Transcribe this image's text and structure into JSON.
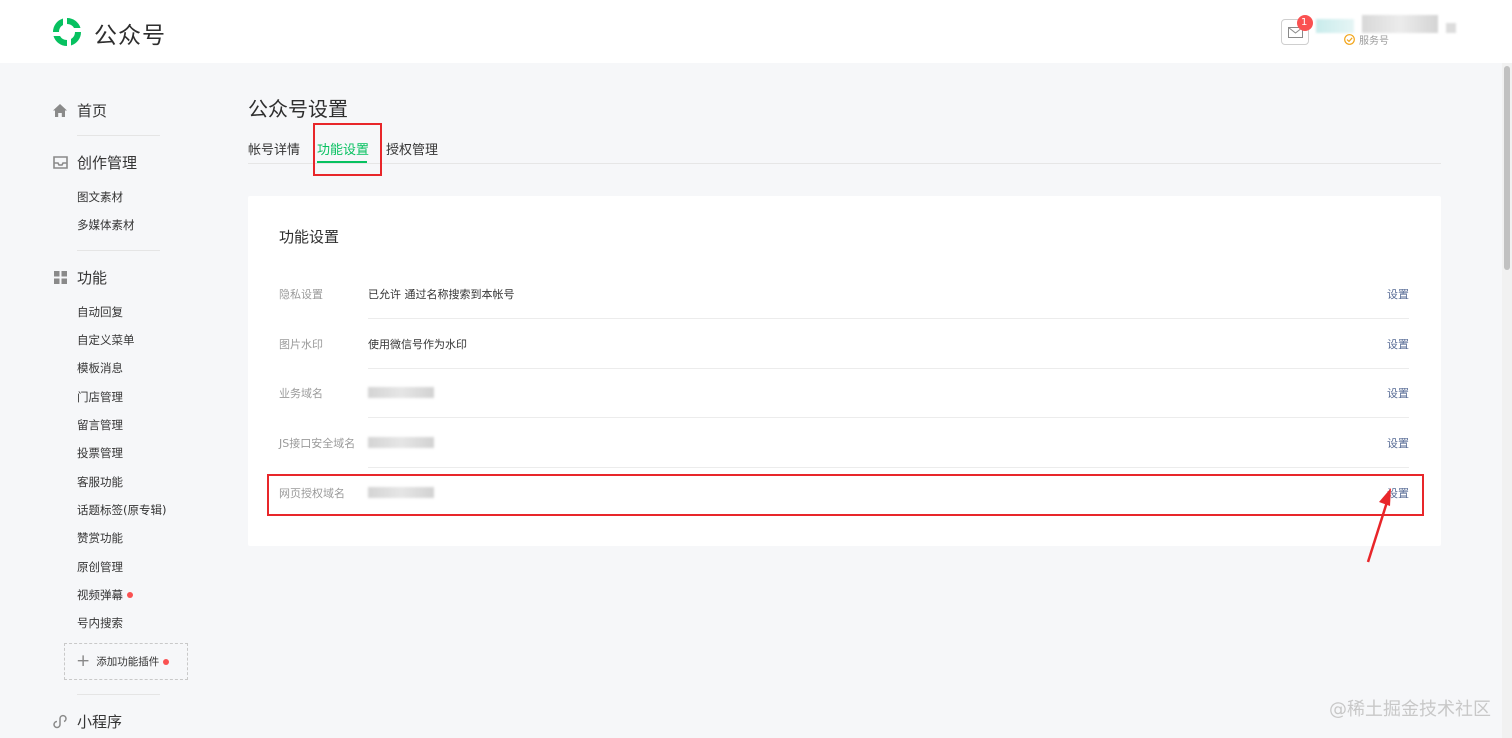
{
  "header": {
    "brand": "公众号",
    "notification_count": "1",
    "account_type": "服务号"
  },
  "sidebar": {
    "home": "首页",
    "creation": {
      "label": "创作管理",
      "items": [
        "图文素材",
        "多媒体素材"
      ]
    },
    "features": {
      "label": "功能",
      "items": [
        "自动回复",
        "自定义菜单",
        "模板消息",
        "门店管理",
        "留言管理",
        "投票管理",
        "客服功能",
        "话题标签(原专辑)",
        "赞赏功能",
        "原创管理",
        "视频弹幕",
        "号内搜索"
      ]
    },
    "add_plugin": "添加功能插件",
    "mini_program": "小程序"
  },
  "main": {
    "title": "公众号设置",
    "tabs": [
      "帐号详情",
      "功能设置",
      "授权管理"
    ],
    "active_tab": "功能设置",
    "card": {
      "title": "功能设置",
      "rows": [
        {
          "label": "隐私设置",
          "value": "已允许 通过名称搜索到本帐号",
          "action": "设置"
        },
        {
          "label": "图片水印",
          "value": "使用微信号作为水印",
          "action": "设置"
        },
        {
          "label": "业务域名",
          "value": "",
          "action": "设置"
        },
        {
          "label": "JS接口安全域名",
          "value": "",
          "action": "设置"
        },
        {
          "label": "网页授权域名",
          "value": "",
          "action": "设置"
        }
      ]
    }
  },
  "watermark": "@稀土掘金技术社区",
  "colors": {
    "accent": "#07c160",
    "highlight": "#e8262a",
    "link": "#576b95",
    "badge": "#fa5151"
  }
}
